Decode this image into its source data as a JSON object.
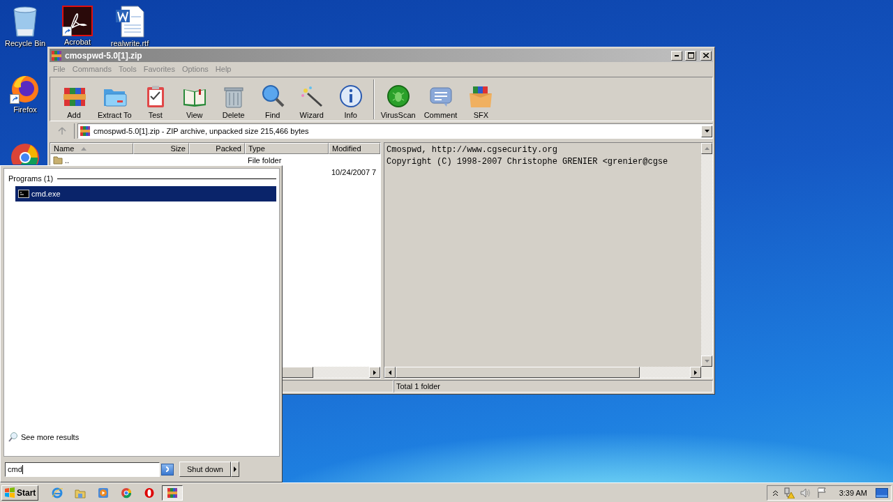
{
  "desktop": {
    "icons": [
      {
        "label": "Recycle Bin",
        "kind": "recycle",
        "shortcut": false
      },
      {
        "label": "Acrobat",
        "kind": "acrobat",
        "shortcut": true
      },
      {
        "label": "realwrite.rtf",
        "kind": "word",
        "shortcut": false
      },
      {
        "label": "Firefox",
        "kind": "firefox",
        "shortcut": true
      },
      {
        "kind": "chrome",
        "shortcut": false
      }
    ]
  },
  "window": {
    "title": "cmospwd-5.0[1].zip",
    "active": false,
    "menu": [
      "File",
      "Commands",
      "Tools",
      "Favorites",
      "Options",
      "Help"
    ],
    "toolbar": [
      {
        "label": "Add",
        "kind": "add",
        "separator": false
      },
      {
        "label": "Extract To",
        "kind": "extract",
        "separator": false
      },
      {
        "label": "Test",
        "kind": "test",
        "separator": false
      },
      {
        "label": "View",
        "kind": "view",
        "separator": false
      },
      {
        "label": "Delete",
        "kind": "delete",
        "separator": false
      },
      {
        "label": "Find",
        "kind": "find",
        "separator": false
      },
      {
        "label": "Wizard",
        "kind": "wizard",
        "separator": false
      },
      {
        "label": "Info",
        "kind": "info",
        "separator": false
      },
      {
        "label": "VirusScan",
        "kind": "virusscan",
        "separator": true
      },
      {
        "label": "Comment",
        "kind": "comment",
        "separator": false
      },
      {
        "label": "SFX",
        "kind": "sfx",
        "separator": false
      }
    ],
    "address": "cmospwd-5.0[1].zip - ZIP archive, unpacked size 215,466 bytes",
    "file_list": {
      "columns": [
        {
          "label": "Name",
          "sorted": true
        },
        {
          "label": "Size",
          "sorted": false
        },
        {
          "label": "Packed",
          "sorted": false
        },
        {
          "label": "Type",
          "sorted": false
        },
        {
          "label": "Modified",
          "sorted": false
        }
      ],
      "rows": [
        {
          "name": "..",
          "type": "File folder"
        },
        {
          "modified": "10/24/2007 7"
        }
      ]
    },
    "comment": [
      "Cmospwd, http://www.cgsecurity.org",
      "Copyright (C) 1998-2007 Christophe GRENIER <grenier@cgse"
    ],
    "status": "Total 1 folder"
  },
  "start_menu": {
    "section": "Programs (1)",
    "results": [
      {
        "label": "cmd.exe",
        "selected": true
      }
    ],
    "more": "See more results",
    "search": {
      "value": "cmd"
    },
    "shutdown": "Shut down"
  },
  "taskbar": {
    "start": "Start",
    "apps": [
      {
        "kind": "ie",
        "active": false
      },
      {
        "kind": "explorer",
        "active": false
      },
      {
        "kind": "media",
        "active": false
      },
      {
        "kind": "chrome",
        "active": false
      },
      {
        "kind": "opera",
        "active": false
      },
      {
        "kind": "winrar",
        "active": true
      }
    ],
    "clock": "3:39 AM"
  }
}
